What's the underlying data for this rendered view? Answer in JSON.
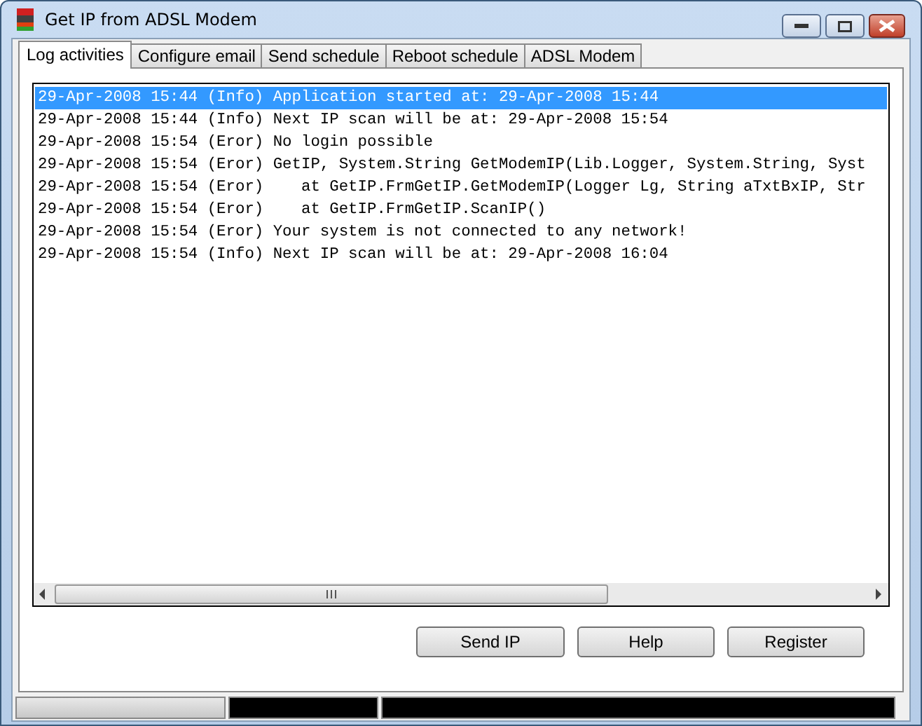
{
  "window": {
    "title": "Get IP from ADSL Modem"
  },
  "tabs": [
    {
      "label": "Log activities",
      "selected": true
    },
    {
      "label": "Configure email",
      "selected": false
    },
    {
      "label": "Send schedule",
      "selected": false
    },
    {
      "label": "Reboot schedule",
      "selected": false
    },
    {
      "label": "ADSL Modem",
      "selected": false
    }
  ],
  "log": [
    {
      "text": "29-Apr-2008 15:44 (Info) Application started at: 29-Apr-2008 15:44",
      "selected": true
    },
    {
      "text": "29-Apr-2008 15:44 (Info) Next IP scan will be at: 29-Apr-2008 15:54",
      "selected": false
    },
    {
      "text": "29-Apr-2008 15:54 (Eror) No login possible",
      "selected": false
    },
    {
      "text": "29-Apr-2008 15:54 (Eror) GetIP, System.String GetModemIP(Lib.Logger, System.String, Syst",
      "selected": false
    },
    {
      "text": "29-Apr-2008 15:54 (Eror)    at GetIP.FrmGetIP.GetModemIP(Logger Lg, String aTxtBxIP, Str",
      "selected": false
    },
    {
      "text": "29-Apr-2008 15:54 (Eror)    at GetIP.FrmGetIP.ScanIP()",
      "selected": false
    },
    {
      "text": "29-Apr-2008 15:54 (Eror) Your system is not connected to any network!",
      "selected": false
    },
    {
      "text": "29-Apr-2008 15:54 (Info) Next IP scan will be at: 29-Apr-2008 16:04",
      "selected": false
    }
  ],
  "buttons": [
    "Send IP",
    "Help",
    "Register"
  ]
}
